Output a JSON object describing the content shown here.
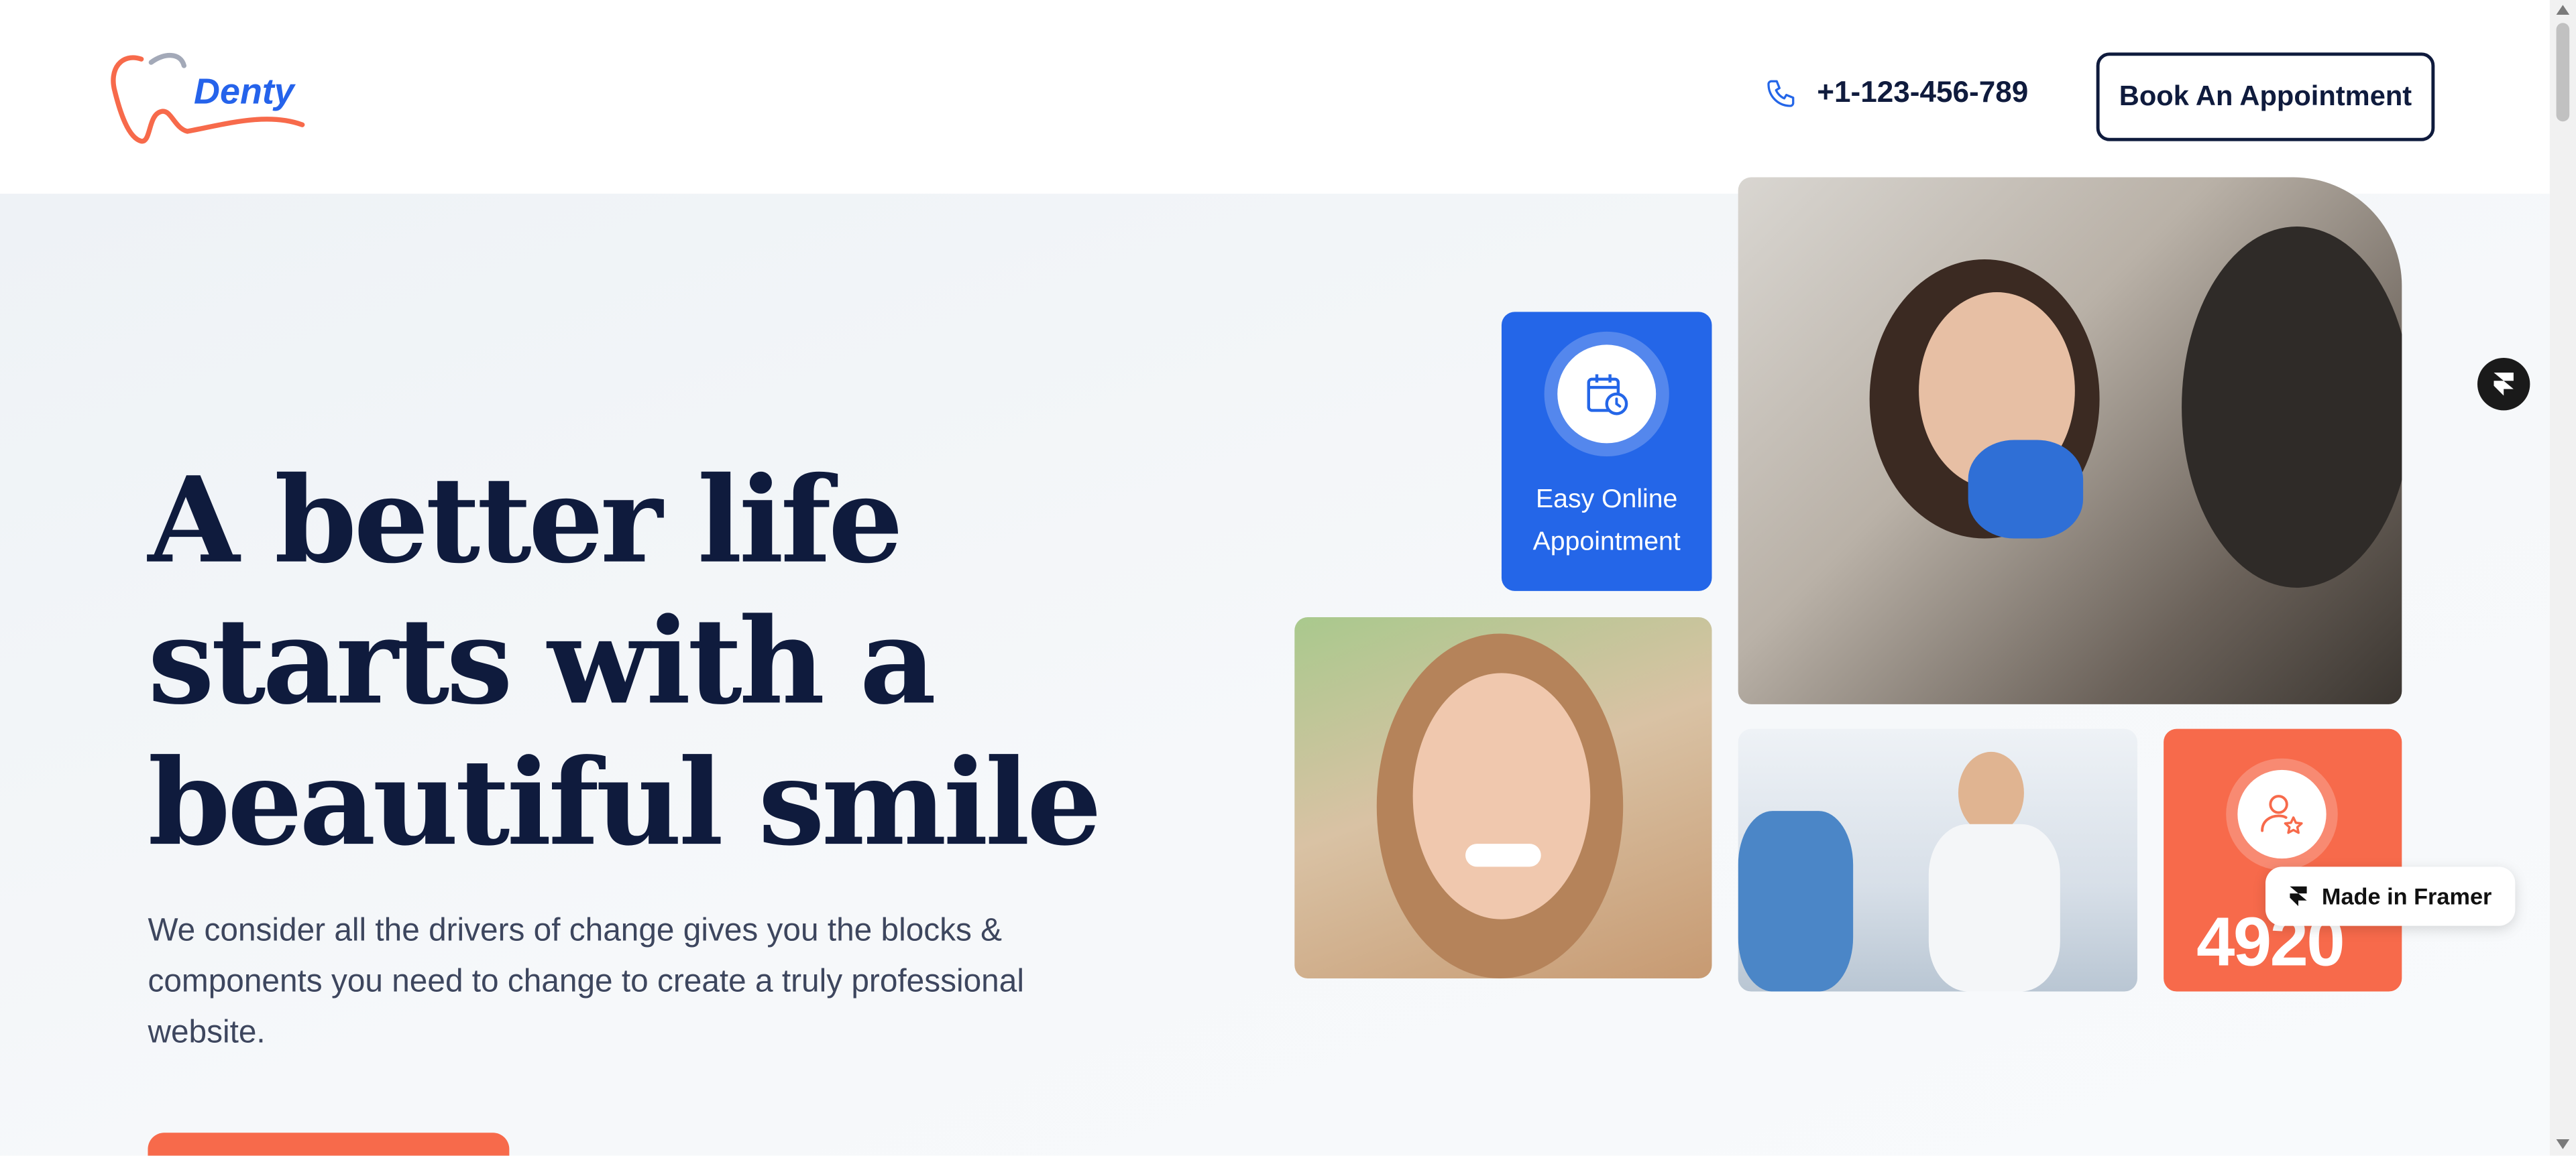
{
  "header": {
    "logo_text": "Denty",
    "phone": "+1-123-456-789",
    "book_label": "Book An Appointment"
  },
  "hero": {
    "title": "A better life starts with a beautiful smile",
    "description": "We consider all the drivers of change gives you the blocks & components you need to change to create a truly professional website."
  },
  "cards": {
    "appointment_label_line1": "Easy Online",
    "appointment_label_line2": "Appointment",
    "patients_count": "4920"
  },
  "badges": {
    "made_in_framer": "Made in Framer"
  },
  "colors": {
    "brand_blue": "#2466e8",
    "accent_orange": "#f76a4b",
    "navy": "#0f1b3d"
  }
}
